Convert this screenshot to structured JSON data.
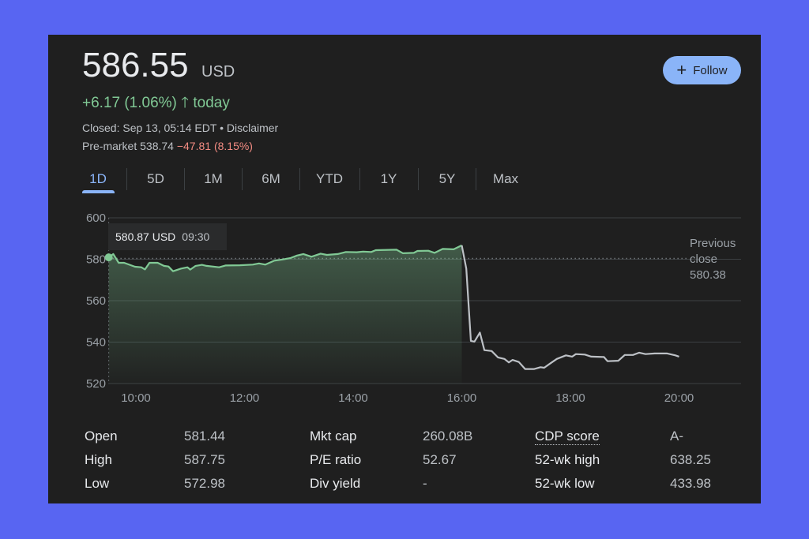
{
  "quote": {
    "price": "586.55",
    "currency": "USD",
    "change": "+6.17 (1.06%)",
    "change_arrow_icon": "arrow-up-icon",
    "change_suffix": "today",
    "closed_text": "Closed: Sep 13, 05:14 EDT",
    "separator": "•",
    "disclaimer": "Disclaimer",
    "premarket_label": "Pre-market 538.74",
    "premarket_change": "−47.81 (8.15%)"
  },
  "follow_button": {
    "icon": "plus-icon",
    "label": "Follow"
  },
  "tabs": [
    {
      "label": "1D",
      "active": true
    },
    {
      "label": "5D"
    },
    {
      "label": "1M"
    },
    {
      "label": "6M"
    },
    {
      "label": "YTD"
    },
    {
      "label": "1Y"
    },
    {
      "label": "5Y"
    },
    {
      "label": "Max"
    }
  ],
  "tooltip": {
    "price": "580.87 USD",
    "time": "09:30"
  },
  "previous_close": {
    "label": "Previous close",
    "value": "580.38"
  },
  "colors": {
    "up": "#81c995",
    "down": "#f28b82",
    "accent": "#8ab4f8",
    "after_hours_line": "#bdc1c6",
    "panel": "#1f1f1f"
  },
  "chart_data": {
    "type": "line",
    "ylim": [
      520,
      600
    ],
    "yticks": [
      "600",
      "580",
      "560",
      "540",
      "520"
    ],
    "xticks": [
      "10:00",
      "12:00",
      "14:00",
      "16:00",
      "18:00",
      "20:00"
    ],
    "xlim": [
      "09:30",
      "21:10"
    ],
    "grid": true,
    "reference_line": 580.38,
    "series": [
      {
        "session": "regular",
        "color": "#81c995",
        "points": [
          [
            "09:30",
            580.9
          ],
          [
            "09:35",
            582.5
          ],
          [
            "09:41",
            578.3
          ],
          [
            "09:47",
            578.3
          ],
          [
            "09:59",
            576.4
          ],
          [
            "10:06",
            576.1
          ],
          [
            "10:10",
            575.1
          ],
          [
            "10:15",
            578.3
          ],
          [
            "10:24",
            578.3
          ],
          [
            "10:31",
            576.8
          ],
          [
            "10:36",
            576.5
          ],
          [
            "10:41",
            574.2
          ],
          [
            "10:50",
            575.5
          ],
          [
            "10:57",
            576.1
          ],
          [
            "11:00",
            575.0
          ],
          [
            "11:06",
            576.8
          ],
          [
            "11:13",
            577.3
          ],
          [
            "11:18",
            576.8
          ],
          [
            "11:32",
            576.1
          ],
          [
            "11:39",
            577.0
          ],
          [
            "11:55",
            577.1
          ],
          [
            "12:09",
            577.4
          ],
          [
            "12:16",
            578.0
          ],
          [
            "12:23",
            577.4
          ],
          [
            "12:33",
            579.3
          ],
          [
            "12:42",
            579.9
          ],
          [
            "12:51",
            580.6
          ],
          [
            "12:58",
            581.8
          ],
          [
            "13:05",
            582.5
          ],
          [
            "13:14",
            581.2
          ],
          [
            "13:24",
            582.7
          ],
          [
            "13:31",
            582.1
          ],
          [
            "13:43",
            582.5
          ],
          [
            "13:52",
            583.5
          ],
          [
            "14:04",
            583.4
          ],
          [
            "14:11",
            583.7
          ],
          [
            "14:20",
            583.5
          ],
          [
            "14:25",
            584.4
          ],
          [
            "14:48",
            584.6
          ],
          [
            "14:55",
            582.9
          ],
          [
            "15:07",
            583.1
          ],
          [
            "15:11",
            584.0
          ],
          [
            "15:23",
            584.1
          ],
          [
            "15:30",
            583.1
          ],
          [
            "15:39",
            585.0
          ],
          [
            "15:51",
            584.8
          ],
          [
            "15:58",
            586.3
          ],
          [
            "16:00",
            586.7
          ]
        ]
      },
      {
        "session": "after-hours",
        "color": "#bdc1c6",
        "points": [
          [
            "16:00",
            586.7
          ],
          [
            "16:05",
            575.5
          ],
          [
            "16:10",
            540.6
          ],
          [
            "16:14",
            540.2
          ],
          [
            "16:20",
            544.6
          ],
          [
            "16:25",
            536.1
          ],
          [
            "16:33",
            535.7
          ],
          [
            "16:40",
            532.6
          ],
          [
            "16:47",
            531.9
          ],
          [
            "16:52",
            530.2
          ],
          [
            "16:56",
            531.4
          ],
          [
            "17:03",
            530.4
          ],
          [
            "17:10",
            527.0
          ],
          [
            "17:20",
            527.0
          ],
          [
            "17:27",
            527.9
          ],
          [
            "17:31",
            527.6
          ],
          [
            "17:38",
            529.8
          ],
          [
            "17:45",
            531.9
          ],
          [
            "17:55",
            533.6
          ],
          [
            "18:02",
            533.0
          ],
          [
            "18:06",
            534.2
          ],
          [
            "18:16",
            534.0
          ],
          [
            "18:23",
            533.0
          ],
          [
            "18:37",
            532.8
          ],
          [
            "18:41",
            530.8
          ],
          [
            "18:53",
            531.0
          ],
          [
            "19:00",
            533.8
          ],
          [
            "19:09",
            533.8
          ],
          [
            "19:16",
            534.9
          ],
          [
            "19:23",
            534.2
          ],
          [
            "19:33",
            534.5
          ],
          [
            "19:47",
            534.5
          ],
          [
            "19:56",
            533.6
          ],
          [
            "20:00",
            533.0
          ]
        ]
      }
    ]
  },
  "stats": [
    {
      "label": "Open",
      "value": "581.44"
    },
    {
      "label": "High",
      "value": "587.75"
    },
    {
      "label": "Low",
      "value": "572.98"
    },
    {
      "label": "Mkt cap",
      "value": "260.08B"
    },
    {
      "label": "P/E ratio",
      "value": "52.67"
    },
    {
      "label": "Div yield",
      "value": "-"
    },
    {
      "label": "CDP score",
      "value": "A-"
    },
    {
      "label": "52-wk high",
      "value": "638.25"
    },
    {
      "label": "52-wk low",
      "value": "433.98"
    }
  ]
}
